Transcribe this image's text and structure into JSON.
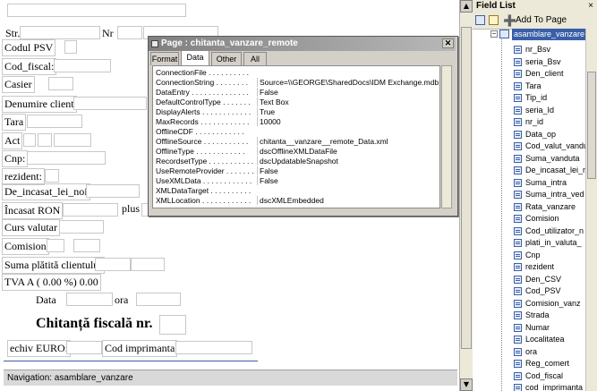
{
  "form": {
    "str_label": "Str.",
    "nr_label": "Nr",
    "cod_psv_label": "Codul PSV",
    "cod_fiscal_label": "Cod_fiscal:",
    "casier_label": "Casier",
    "denumire_client_label": "Denumire client",
    "tara_label": "Tara",
    "act_label": "Act",
    "cnp_label": "Cnp:",
    "rezident_label": "rezident:",
    "de_incasat_label": "De_incasat_lei_noi",
    "incasat_ron_label": "Încasat RON",
    "plus_label": "plus",
    "curs_valutar_label": "Curs valutar",
    "comision_label": "Comision",
    "suma_platita_label": "Suma plătită clientului",
    "tva_label": "TVA A ( 0.00 %) 0.00",
    "data_label": "Data",
    "ora_label": "ora",
    "chitanta_label": "Chitanță fiscală",
    "nr2_label": "nr.",
    "echiv_euro_label": "echiv EURO:",
    "cod_imprimanta_label": "Cod imprimanta"
  },
  "navigation": {
    "label": "Navigation: asamblare_vanzare"
  },
  "dialog": {
    "title": "Page : chitanta_vanzare_remote",
    "tabs": [
      "Format",
      "Data",
      "Other",
      "All"
    ],
    "active_tab": "Data",
    "properties": [
      {
        "name": "ConnectionFile . . . . . . . . . .",
        "value": ""
      },
      {
        "name": "ConnectionString . . . . . . . .",
        "value": "Source=\\\\GEORGE\\SharedDocs\\IDM Exchange.mdb;I"
      },
      {
        "name": "DataEntry . . . . . . . . . . . . . .",
        "value": "False"
      },
      {
        "name": "DefaultControlType . . . . . . .",
        "value": "Text Box"
      },
      {
        "name": "DisplayAlerts . . . . . . . . . . . .",
        "value": "True"
      },
      {
        "name": "MaxRecords . . . . . . . . . . . .",
        "value": "10000"
      },
      {
        "name": "OfflineCDF . . . . . . . . . . . .",
        "value": ""
      },
      {
        "name": "OfflineSource . . . . . . . . . . .",
        "value": "chitanta__vanzare__remote_Data.xml"
      },
      {
        "name": "OfflineType . . . . . . . . . . . .",
        "value": "dscOfflineXMLDataFile"
      },
      {
        "name": "RecordsetType . . . . . . . . . . .",
        "value": "dscUpdatableSnapshot"
      },
      {
        "name": "UseRemoteProvider . . . . . . . .",
        "value": "False"
      },
      {
        "name": "UseXMLData . . . . . . . . . . . .",
        "value": "False"
      },
      {
        "name": "XMLDataTarget . . . . . . . . . .",
        "value": ""
      },
      {
        "name": "XMLLocation . . . . . . . . . . . .",
        "value": "dscXMLEmbedded"
      }
    ]
  },
  "field_list": {
    "title": "Field List",
    "close": "×",
    "add_to_page": "Add To Page",
    "root": "asamblare_vanzare",
    "fields": [
      "nr_Bsv",
      "seria_Bsv",
      "Den_client",
      "Tara",
      "Tip_id",
      "seria_Id",
      "nr_id",
      "Data_op",
      "Cod_valut_vandut",
      "Suma_vanduta",
      "De_incasat_lei_n",
      "Suma_intra",
      "Suma_intra_ved",
      "Rata_vanzare",
      "Comision",
      "Cod_utilizator_n",
      "plati_in_valuta_",
      "Cnp",
      "rezident",
      "Den_CSV",
      "Cod_PSV",
      "Comision_vanz",
      "Strada",
      "Numar",
      "Localitatea",
      "ora",
      "Reg_comert",
      "Cod_fiscal",
      "cod_imprimanta"
    ]
  },
  "colors": {
    "dialog_bg": "#d4d0c8",
    "title_gradient_start": "#808080",
    "panel_bg": "#ece9d8",
    "field_icon": "#3a5fa8"
  }
}
